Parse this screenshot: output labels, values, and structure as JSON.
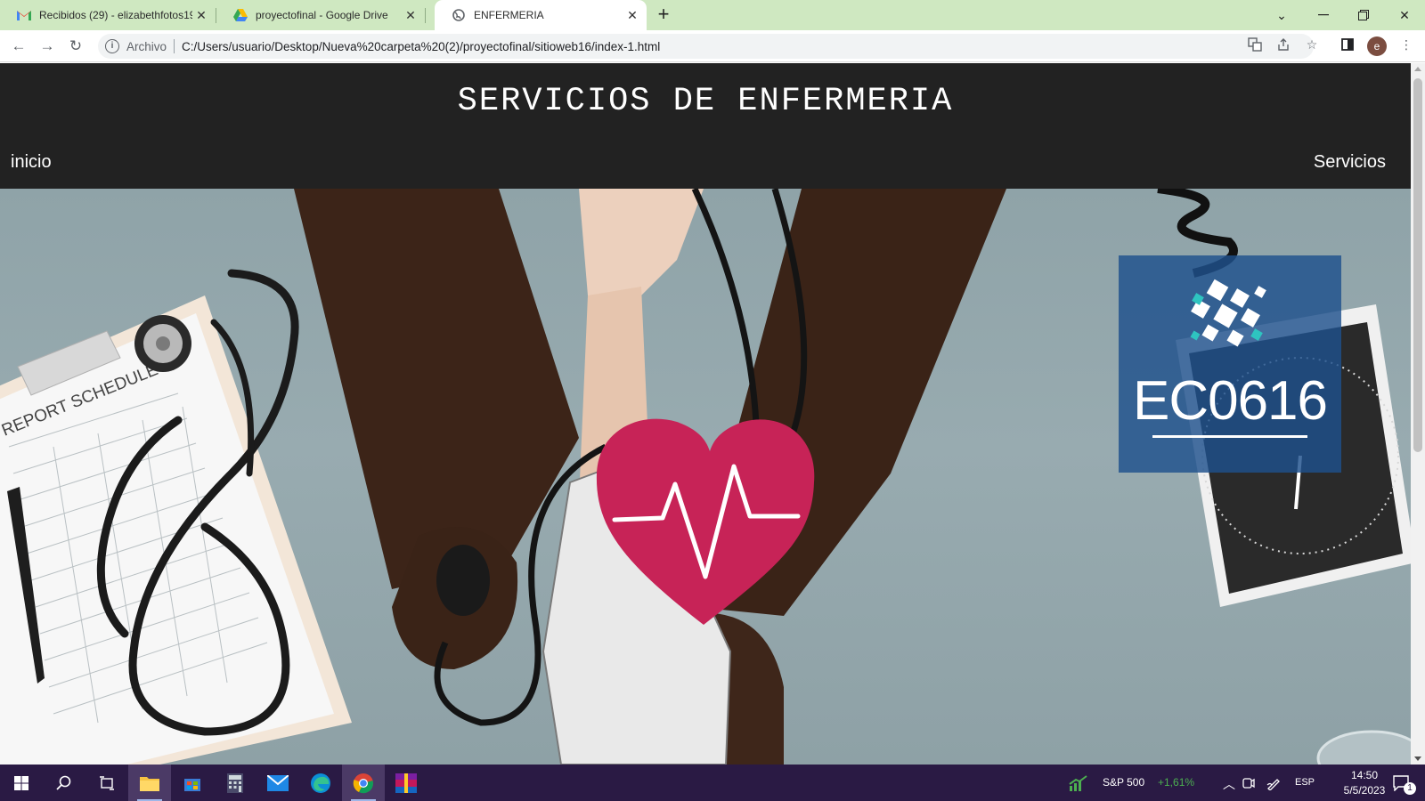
{
  "browser": {
    "tabs": [
      {
        "title": "Recibidos (29) - elizabethfotos19",
        "icon": "gmail-icon"
      },
      {
        "title": "proyectofinal - Google Drive",
        "icon": "google-drive-icon"
      },
      {
        "title": "ENFERMERIA",
        "icon": "globe-icon",
        "active": true
      }
    ],
    "new_tab": "+",
    "address": {
      "protocol_label": "Archivo",
      "url": "C:/Users/usuario/Desktop/Nueva%20carpeta%20(2)/proyectofinal/sitioweb16/index-1.html"
    },
    "profile_initial": "e"
  },
  "page": {
    "title": "SERVICIOS DE ENFERMERIA",
    "nav": {
      "left": "inicio",
      "right": "Servicios"
    },
    "hero": {
      "clipboard_text": "REPORT SCHEDULE",
      "logo_text": "EC0616"
    }
  },
  "taskbar": {
    "stock_name": "S&P 500",
    "stock_change": "+1,61%",
    "language": "ESP",
    "time": "14:50",
    "date": "5/5/2023",
    "notification_count": "1"
  },
  "colors": {
    "tab_strip": "#cfe8c1",
    "site_header": "#222222",
    "heart": "#c72357",
    "logo_box": "#1e508c",
    "taskbar": "#2a1a44",
    "stock_up": "#4caf50"
  }
}
